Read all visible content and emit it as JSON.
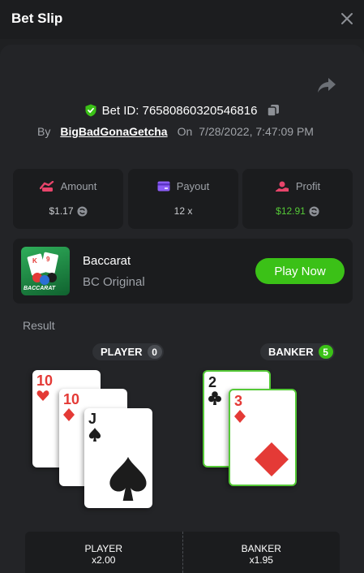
{
  "header": {
    "title": "Bet Slip"
  },
  "bet": {
    "id_label": "Bet ID: 76580860320546816",
    "by_label": "By",
    "username": "BigBadGonaGetcha",
    "on_label": "On",
    "date": "7/28/2022, 7:47:09 PM"
  },
  "stats": {
    "amount": {
      "label": "Amount",
      "value": "$1.17"
    },
    "payout": {
      "label": "Payout",
      "value": "12 x"
    },
    "profit": {
      "label": "Profit",
      "value": "$12.91"
    }
  },
  "game": {
    "name": "Baccarat",
    "subtitle": "BC Original",
    "thumb_text": "BACCARAT",
    "play_label": "Play Now"
  },
  "result": {
    "label": "Result",
    "player": {
      "label": "PLAYER",
      "score": "0",
      "cards": [
        {
          "rank": "10",
          "suit": "hearts"
        },
        {
          "rank": "10",
          "suit": "diamonds"
        },
        {
          "rank": "J",
          "suit": "spades"
        }
      ]
    },
    "banker": {
      "label": "BANKER",
      "score": "5",
      "cards": [
        {
          "rank": "2",
          "suit": "clubs"
        },
        {
          "rank": "3",
          "suit": "diamonds"
        }
      ]
    }
  },
  "bets_table": {
    "player": {
      "label": "PLAYER",
      "odds": "x2.00"
    },
    "banker": {
      "label": "BANKER",
      "odds": "x1.95"
    }
  },
  "colors": {
    "accent_green": "#3bc117",
    "profit_green": "#55c937",
    "red_suit": "#e43a36",
    "background": "#232427"
  }
}
